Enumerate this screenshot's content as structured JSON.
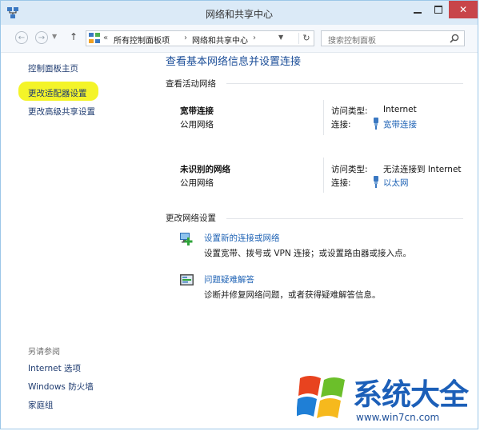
{
  "window": {
    "title": "网络和共享中心"
  },
  "address": {
    "chevron": "«",
    "crumbs": [
      "所有控制面板项",
      "网络和共享中心"
    ],
    "separator": "›",
    "refresh": "↻"
  },
  "search": {
    "placeholder": "搜索控制面板"
  },
  "sidebar": {
    "items": [
      "控制面板主页",
      "更改适配器设置",
      "更改高级共享设置"
    ],
    "see_also_title": "另请参阅",
    "see_also": [
      "Internet 选项",
      "Windows 防火墙",
      "家庭组"
    ]
  },
  "main": {
    "title": "查看基本网络信息并设置连接",
    "active_networks_title": "查看活动网络",
    "networks": [
      {
        "name": "宽带连接",
        "category": "公用网络",
        "access_label": "访问类型:",
        "access_value": "Internet",
        "conn_label": "连接:",
        "conn_value": "宽带连接"
      },
      {
        "name": "未识别的网络",
        "category": "公用网络",
        "access_label": "访问类型:",
        "access_value": "无法连接到 Internet",
        "conn_label": "连接:",
        "conn_value": "以太网"
      }
    ],
    "change_settings_title": "更改网络设置",
    "tasks": [
      {
        "link": "设置新的连接或网络",
        "desc": "设置宽带、拨号或 VPN 连接；或设置路由器或接入点。",
        "icon": "new-connection-icon"
      },
      {
        "link": "问题疑难解答",
        "desc": "诊断并修复网络问题，或者获得疑难解答信息。",
        "icon": "troubleshoot-icon"
      }
    ]
  },
  "watermark": {
    "title": "系统大全",
    "url": "www.win7cn.com"
  },
  "colors": {
    "link": "#1f63b5",
    "title": "#1d4f99",
    "highlight": "#f3f31e",
    "close": "#c8454a"
  }
}
